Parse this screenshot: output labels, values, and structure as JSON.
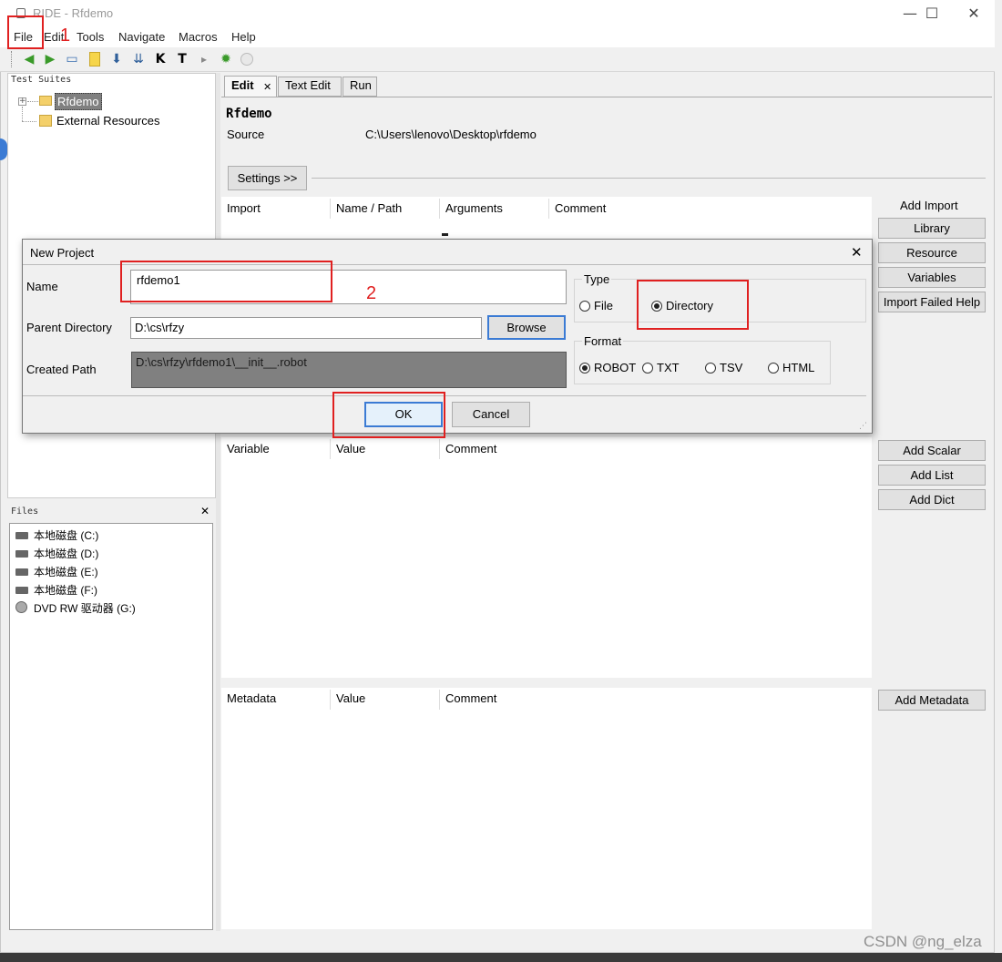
{
  "window": {
    "title": "RIDE - Rfdemo",
    "minimize": "—",
    "maximize": "☐",
    "close": "✕"
  },
  "menu": [
    "File",
    "Edit",
    "Tools",
    "Navigate",
    "Macros",
    "Help"
  ],
  "toolbar_icons": [
    "back-icon",
    "forward-icon",
    "open-directory-icon",
    "new-file-icon",
    "save-icon",
    "save-all-icon",
    "search-keywords-icon",
    "search-tests-icon",
    "run-icon",
    "debug-icon",
    "stop-icon"
  ],
  "test_suites": {
    "header": "Test Suites",
    "expander": "+",
    "items": [
      "Rfdemo",
      "External Resources"
    ]
  },
  "files": {
    "header": "Files",
    "close": "✕",
    "items": [
      "本地磁盘 (C:)",
      "本地磁盘 (D:)",
      "本地磁盘 (E:)",
      "本地磁盘 (F:)",
      "DVD RW 驱动器 (G:)"
    ]
  },
  "tabs": {
    "edit": "Edit",
    "edit_close": "✕",
    "text_edit": "Text Edit",
    "run": "Run"
  },
  "editor": {
    "suite_name": "Rfdemo",
    "source_label": "Source",
    "source_value": "C:\\Users\\lenovo\\Desktop\\rfdemo",
    "settings_button": "Settings >>",
    "import_headers": [
      "Import",
      "Name / Path",
      "Arguments",
      "Comment"
    ],
    "add_import_label": "Add Import",
    "import_buttons": [
      "Library",
      "Resource",
      "Variables",
      "Import Failed Help"
    ],
    "variable_headers": [
      "Variable",
      "Value",
      "Comment"
    ],
    "variable_buttons": [
      "Add Scalar",
      "Add List",
      "Add Dict"
    ],
    "metadata_headers": [
      "Metadata",
      "Value",
      "Comment"
    ],
    "metadata_button": "Add Metadata"
  },
  "dialog": {
    "title": "New Project",
    "close": "✕",
    "name_label": "Name",
    "name_value": "rfdemo1",
    "parent_label": "Parent Directory",
    "parent_value": "D:\\cs\\rfzy",
    "browse_button": "Browse",
    "created_label": "Created Path",
    "created_value": "D:\\cs\\rfzy\\rfdemo1\\__init__.robot",
    "type_label": "Type",
    "type_options": [
      "File",
      "Directory"
    ],
    "type_selected": "Directory",
    "format_label": "Format",
    "format_options": [
      "ROBOT",
      "TXT",
      "TSV",
      "HTML"
    ],
    "format_selected": "ROBOT",
    "ok_button": "OK",
    "cancel_button": "Cancel"
  },
  "annotations": {
    "step1": "1",
    "step2": "2"
  },
  "watermark": "CSDN @ng_elza",
  "colors": {
    "annotation_red": "#e02020",
    "selection_gray": "#808080",
    "focus_blue": "#3b7bd4"
  }
}
